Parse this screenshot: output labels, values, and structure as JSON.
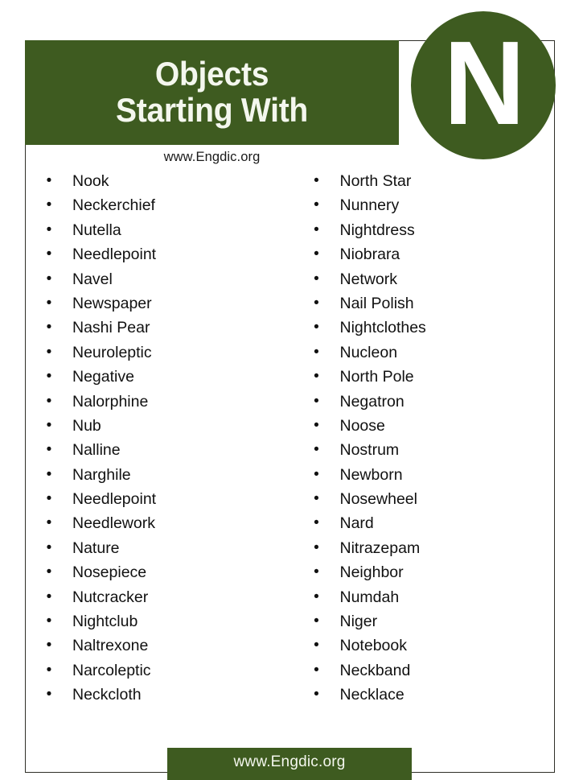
{
  "page": {
    "background_color": "#ffffff",
    "accent_color": "#3e5b20",
    "text_color": "#111111"
  },
  "header": {
    "title_line1": "Objects",
    "title_line2": "Starting With",
    "badge_letter": "N",
    "subtitle": "www.Engdic.org"
  },
  "list": {
    "bullet_glyph": "•",
    "left_column": [
      "Nook",
      "Neckerchief",
      "Nutella",
      "Needlepoint",
      "Navel",
      "Newspaper",
      "Nashi Pear",
      "Neuroleptic",
      "Negative",
      "Nalorphine",
      "Nub",
      "Nalline",
      "Narghile",
      "Needlepoint",
      "Needlework",
      "Nature",
      "Nosepiece",
      "Nutcracker",
      "Nightclub",
      "Naltrexone",
      "Narcoleptic",
      "Neckcloth"
    ],
    "right_column": [
      "North Star",
      "Nunnery",
      "Nightdress",
      "Niobrara",
      "Network",
      "Nail Polish",
      "Nightclothes",
      "Nucleon",
      "North Pole",
      "Negatron",
      "Noose",
      "Nostrum",
      "Newborn",
      "Nosewheel",
      "Nard",
      "Nitrazepam",
      "Neighbor",
      "Numdah",
      "Niger",
      "Notebook",
      "Neckband",
      "Necklace"
    ]
  },
  "footer": {
    "text": "www.Engdic.org"
  }
}
